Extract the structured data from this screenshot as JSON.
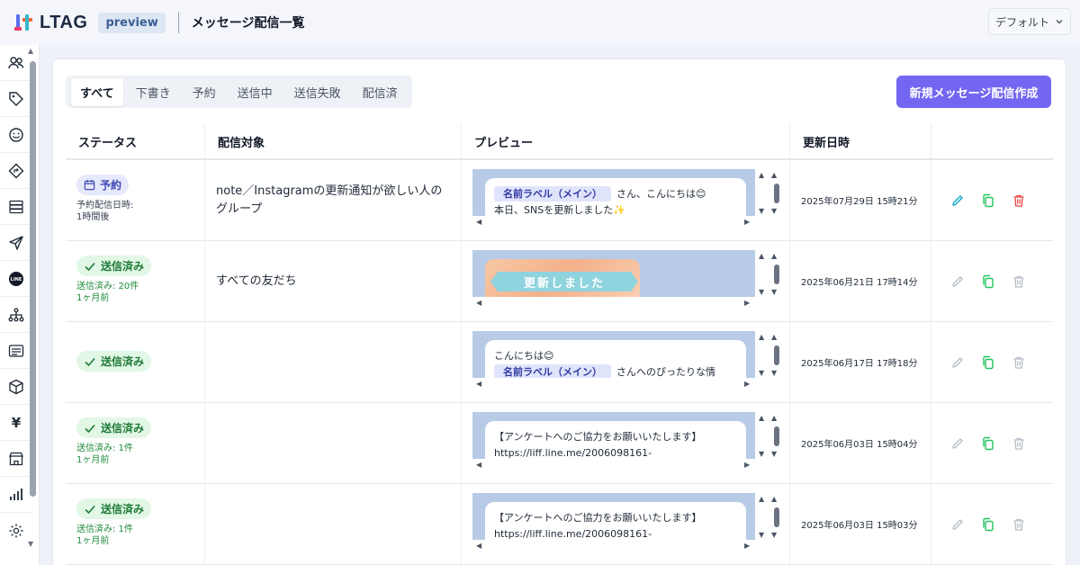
{
  "header": {
    "logo_text": "LTAG",
    "preview_badge": "preview",
    "page_title": "メッセージ配信一覧",
    "view_select": "デフォルト"
  },
  "sidebar": {
    "icons": [
      "users-icon",
      "tag-icon",
      "smile-icon",
      "route-sign-icon",
      "database-icon",
      "send-icon",
      "line-icon",
      "sitemap-icon",
      "message-list-icon",
      "box-icon",
      "yen-icon",
      "store-icon",
      "bar-chart-icon",
      "gear-icon"
    ],
    "line_label": "LINE",
    "yen_glyph": "¥"
  },
  "tabs": [
    "すべて",
    "下書き",
    "予約",
    "送信中",
    "送信失敗",
    "配信済"
  ],
  "create_button": "新規メッセージ配信作成",
  "columns": {
    "status": "ステータス",
    "target": "配信対象",
    "preview": "プレビュー",
    "updated": "更新日時"
  },
  "rows": [
    {
      "status": "予約",
      "status_kind": "reserve",
      "sub1": "予約配信日時:",
      "sub2": "1時間後",
      "target": "note／Instagramの更新通知が欲しい人のグループ",
      "preview_chip": "名前ラベル（メイン）",
      "preview_line1": "さん、こんにちは😊",
      "preview_line2": "本日、SNSを更新しました✨",
      "updated": "2025年07月29日 15時21分"
    },
    {
      "status": "送信済み",
      "status_kind": "sent",
      "sub1": "送信済み: 20件",
      "sub2": "1ヶ月前",
      "target": "すべての友だち",
      "preview_image_text": "更新しました",
      "updated": "2025年06月21日 17時14分"
    },
    {
      "status": "送信済み",
      "status_kind": "sent",
      "sub1": "",
      "sub2": "",
      "target": "",
      "preview_line1": "こんにちは😊",
      "preview_chip": "名前ラベル（メイン）",
      "preview_line2": "さんへのぴったりな情",
      "updated": "2025年06月17日 17時18分"
    },
    {
      "status": "送信済み",
      "status_kind": "sent",
      "sub1": "送信済み: 1件",
      "sub2": "1ヶ月前",
      "target": "",
      "preview_line1": "【アンケートへのご協力をお願いいたします】",
      "preview_line2": "https://liff.line.me/2006098161-",
      "updated": "2025年06月03日 15時04分"
    },
    {
      "status": "送信済み",
      "status_kind": "sent",
      "sub1": "送信済み: 1件",
      "sub2": "1ヶ月前",
      "target": "",
      "preview_line1": "【アンケートへのご協力をお願いいたします】",
      "preview_line2": "https://liff.line.me/2006098161-",
      "updated": "2025年06月03日 15時03分"
    }
  ],
  "colors": {
    "accent": "#7366f0",
    "reserve_badge_bg": "#e6e8fb",
    "sent_badge_bg": "#e2f7e6",
    "edit_active": "#0ea5c6",
    "copy": "#22c55e",
    "delete_active": "#ef4444",
    "disabled": "#b8bec8"
  }
}
